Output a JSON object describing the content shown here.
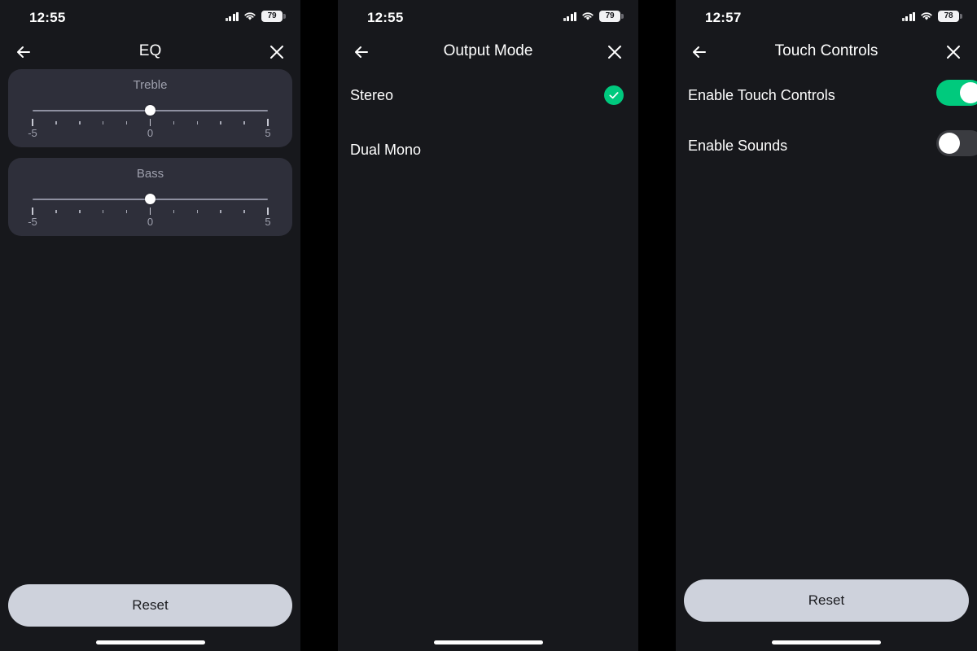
{
  "panels": [
    {
      "id": "eq",
      "status": {
        "time": "12:55",
        "battery": "79",
        "signal_icon": "cellular-signal-icon",
        "wifi_icon": "wifi-icon",
        "battery_icon": "battery-icon"
      },
      "nav": {
        "title": "EQ",
        "back_icon": "back-arrow-icon",
        "close_icon": "close-icon"
      },
      "sliders": [
        {
          "name": "Treble",
          "value": 0,
          "min": -5,
          "max": 5,
          "tick_count": 11,
          "labels": [
            {
              "text": "-5",
              "pos": 0
            },
            {
              "text": "0",
              "pos": 50
            },
            {
              "text": "5",
              "pos": 100
            }
          ]
        },
        {
          "name": "Bass",
          "value": 0,
          "min": -5,
          "max": 5,
          "tick_count": 11,
          "labels": [
            {
              "text": "-5",
              "pos": 0
            },
            {
              "text": "0",
              "pos": 50
            },
            {
              "text": "5",
              "pos": 100
            }
          ]
        }
      ],
      "reset_label": "Reset"
    },
    {
      "id": "output",
      "status": {
        "time": "12:55",
        "battery": "79"
      },
      "nav": {
        "title": "Output Mode"
      },
      "options": [
        {
          "label": "Stereo",
          "selected": true
        },
        {
          "label": "Dual Mono",
          "selected": false
        }
      ]
    },
    {
      "id": "touch",
      "status": {
        "time": "12:57",
        "battery": "78"
      },
      "nav": {
        "title": "Touch Controls"
      },
      "toggles": [
        {
          "label": "Enable Touch Controls",
          "on": true
        },
        {
          "label": "Enable Sounds",
          "on": false
        }
      ],
      "reset_label": "Reset"
    }
  ],
  "colors": {
    "background": "#17181c",
    "card": "#2e2f3a",
    "accent_green": "#00ca7d",
    "reset_button": "#ced2dc",
    "gutter": "#000000"
  }
}
